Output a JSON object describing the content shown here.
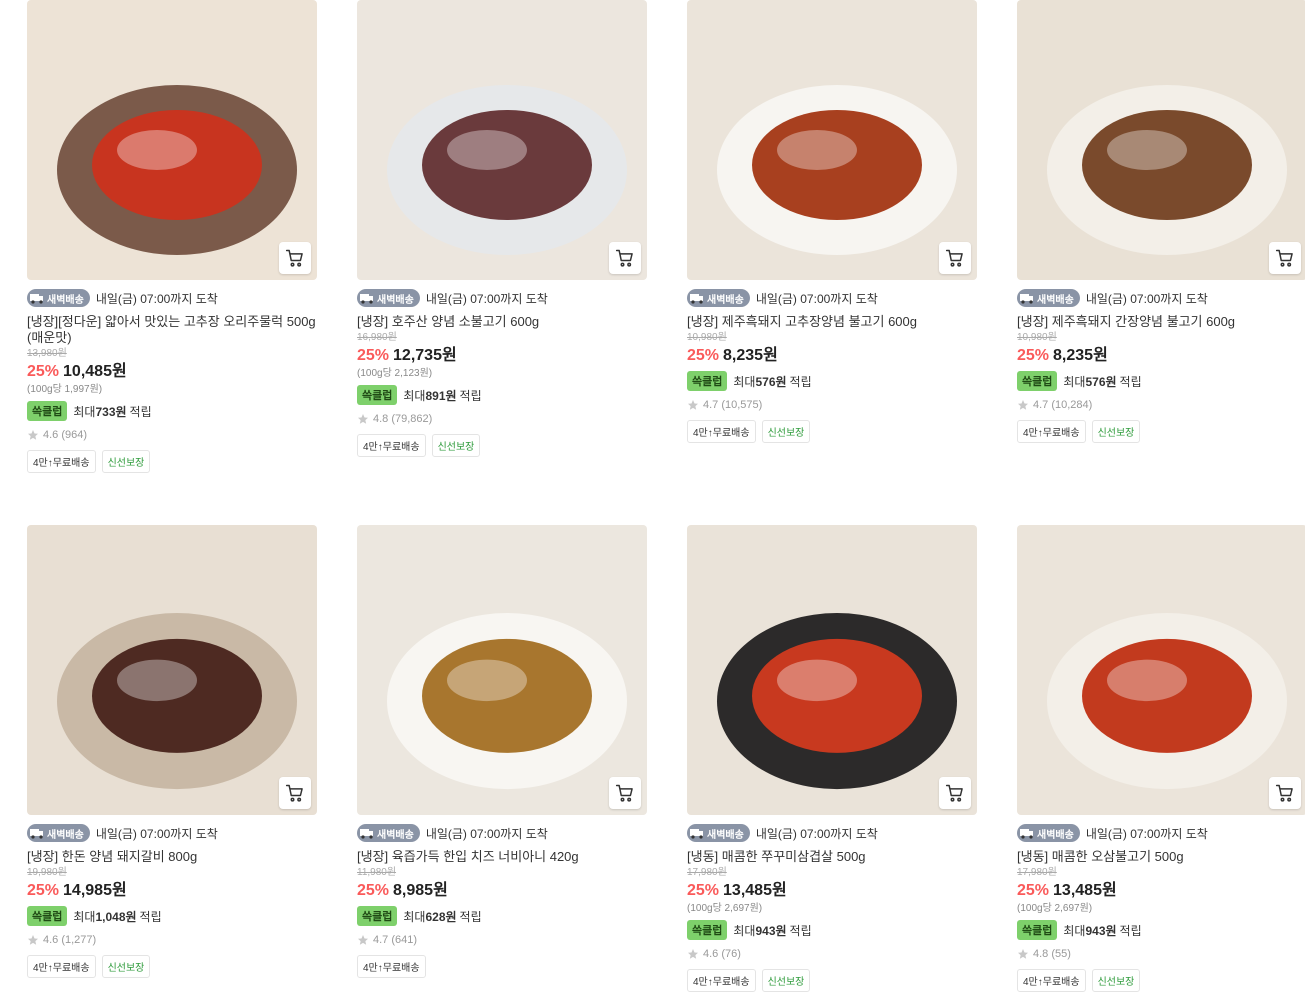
{
  "delivery": {
    "badge": "새벽배송",
    "eta": "내일(금) 07:00까지 도착"
  },
  "points_badge": "쓱클럽",
  "points_prefix": "최대",
  "points_suffix": "적립",
  "tags": {
    "free_shipping": "4만↑무료배송",
    "fresh": "신선보장"
  },
  "products": [
    {
      "name": "[냉장][정다운] 얇아서 맛있는 고추장 오리주물럭 500g (매운맛)",
      "original_price": "13,980원",
      "discount": "25%",
      "price": "10,485원",
      "unit_price": "(100g당 1,997원)",
      "points": "733원",
      "rating": "4.6 (964)",
      "fresh": true,
      "palette": [
        "#ede3d6",
        "#7b5a4a",
        "#c8341f"
      ]
    },
    {
      "name": "[냉장] 호주산 양념 소불고기 600g",
      "original_price": "16,980원",
      "discount": "25%",
      "price": "12,735원",
      "unit_price": "(100g당 2,123원)",
      "points": "891원",
      "rating": "4.8 (79,862)",
      "fresh": true,
      "palette": [
        "#ece6de",
        "#e6e8ea",
        "#6a3a3c"
      ]
    },
    {
      "name": "[냉장] 제주흑돼지 고추장양념 불고기 600g",
      "original_price": "10,980원",
      "discount": "25%",
      "price": "8,235원",
      "unit_price": "",
      "points": "576원",
      "rating": "4.7 (10,575)",
      "fresh": true,
      "palette": [
        "#ebe4da",
        "#f7f5f1",
        "#a8401f"
      ]
    },
    {
      "name": "[냉장] 제주흑돼지 간장양념 불고기 600g",
      "original_price": "10,980원",
      "discount": "25%",
      "price": "8,235원",
      "unit_price": "",
      "points": "576원",
      "rating": "4.7 (10,284)",
      "fresh": true,
      "palette": [
        "#e9e1d5",
        "#f3efe8",
        "#7a4a2c"
      ]
    },
    {
      "name": "[냉장] 한돈 양념 돼지갈비 800g",
      "original_price": "19,980원",
      "discount": "25%",
      "price": "14,985원",
      "unit_price": "",
      "points": "1,048원",
      "rating": "4.6 (1,277)",
      "fresh": true,
      "palette": [
        "#e8dfd3",
        "#c9b9a6",
        "#4e2a22"
      ]
    },
    {
      "name": "[냉장] 육즙가득 한입 치즈 너비아니 420g",
      "original_price": "11,980원",
      "discount": "25%",
      "price": "8,985원",
      "unit_price": "",
      "points": "628원",
      "rating": "4.7 (641)",
      "fresh": false,
      "palette": [
        "#ece7df",
        "#f8f6f2",
        "#a8762e"
      ]
    },
    {
      "name": "[냉동] 매콤한 쭈꾸미삼겹살 500g",
      "original_price": "17,980원",
      "discount": "25%",
      "price": "13,485원",
      "unit_price": "(100g당 2,697원)",
      "points": "943원",
      "rating": "4.6 (76)",
      "fresh": true,
      "palette": [
        "#eae3d9",
        "#2c2a2a",
        "#c8391f"
      ]
    },
    {
      "name": "[냉동] 매콤한 오삼불고기 500g",
      "original_price": "17,980원",
      "discount": "25%",
      "price": "13,485원",
      "unit_price": "(100g당 2,697원)",
      "points": "943원",
      "rating": "4.8 (55)",
      "fresh": true,
      "palette": [
        "#ebe4da",
        "#f3efe8",
        "#c23a1e"
      ]
    }
  ]
}
